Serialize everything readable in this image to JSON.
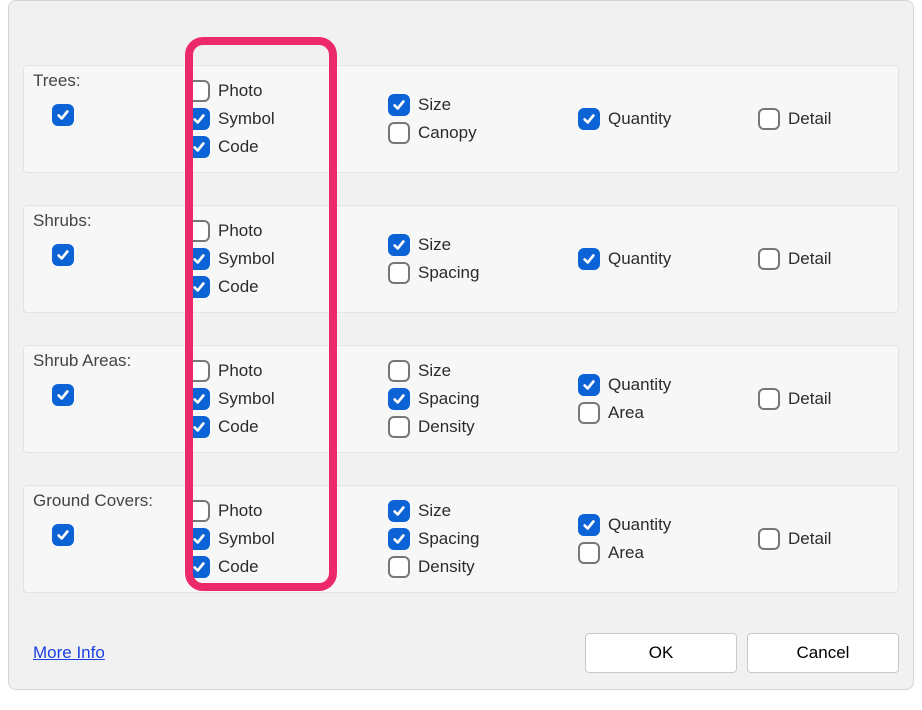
{
  "sections": {
    "trees": {
      "label": "Trees:",
      "master": true,
      "col1": {
        "photo": {
          "label": "Photo",
          "checked": false
        },
        "symbol": {
          "label": "Symbol",
          "checked": true
        },
        "code": {
          "label": "Code",
          "checked": true
        }
      },
      "col2": {
        "size": {
          "label": "Size",
          "checked": true
        },
        "canopy": {
          "label": "Canopy",
          "checked": false
        }
      },
      "col3": {
        "quantity": {
          "label": "Quantity",
          "checked": true
        }
      },
      "col4": {
        "detail": {
          "label": "Detail",
          "checked": false
        }
      }
    },
    "shrubs": {
      "label": "Shrubs:",
      "master": true,
      "col1": {
        "photo": {
          "label": "Photo",
          "checked": false
        },
        "symbol": {
          "label": "Symbol",
          "checked": true
        },
        "code": {
          "label": "Code",
          "checked": true
        }
      },
      "col2": {
        "size": {
          "label": "Size",
          "checked": true
        },
        "spacing": {
          "label": "Spacing",
          "checked": false
        }
      },
      "col3": {
        "quantity": {
          "label": "Quantity",
          "checked": true
        }
      },
      "col4": {
        "detail": {
          "label": "Detail",
          "checked": false
        }
      }
    },
    "shrub_areas": {
      "label": "Shrub Areas:",
      "master": true,
      "col1": {
        "photo": {
          "label": "Photo",
          "checked": false
        },
        "symbol": {
          "label": "Symbol",
          "checked": true
        },
        "code": {
          "label": "Code",
          "checked": true
        }
      },
      "col2": {
        "size": {
          "label": "Size",
          "checked": false
        },
        "spacing": {
          "label": "Spacing",
          "checked": true
        },
        "density": {
          "label": "Density",
          "checked": false
        }
      },
      "col3": {
        "quantity": {
          "label": "Quantity",
          "checked": true
        },
        "area": {
          "label": "Area",
          "checked": false
        }
      },
      "col4": {
        "detail": {
          "label": "Detail",
          "checked": false
        }
      }
    },
    "ground_covers": {
      "label": "Ground Covers:",
      "master": true,
      "col1": {
        "photo": {
          "label": "Photo",
          "checked": false
        },
        "symbol": {
          "label": "Symbol",
          "checked": true
        },
        "code": {
          "label": "Code",
          "checked": true
        }
      },
      "col2": {
        "size": {
          "label": "Size",
          "checked": true
        },
        "spacing": {
          "label": "Spacing",
          "checked": true
        },
        "density": {
          "label": "Density",
          "checked": false
        }
      },
      "col3": {
        "quantity": {
          "label": "Quantity",
          "checked": true
        },
        "area": {
          "label": "Area",
          "checked": false
        }
      },
      "col4": {
        "detail": {
          "label": "Detail",
          "checked": false
        }
      }
    }
  },
  "footer": {
    "more_info": "More Info",
    "ok": "OK",
    "cancel": "Cancel"
  }
}
